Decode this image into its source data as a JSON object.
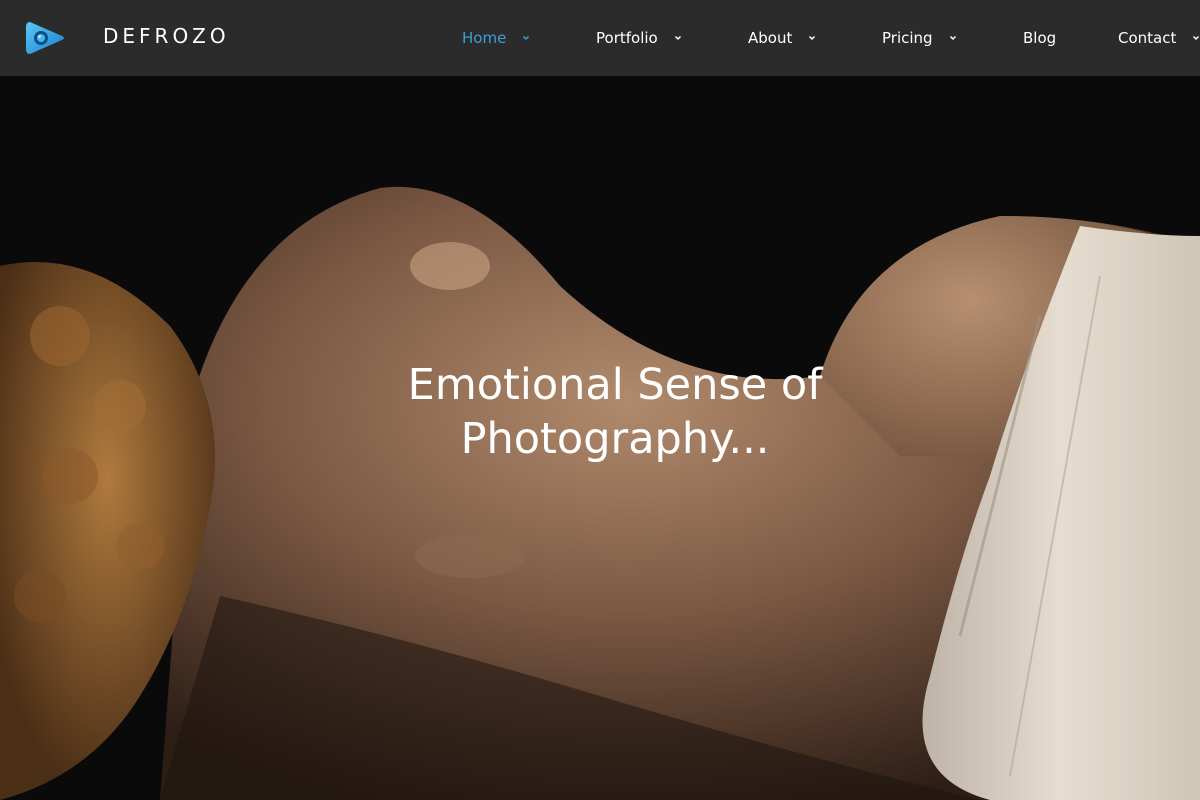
{
  "brand": {
    "name": "DEFROZO",
    "logo_icon": "play-camera-icon",
    "accent_color": "#3a9fd9"
  },
  "nav": {
    "items": [
      {
        "label": "Home",
        "active": true,
        "has_dropdown": true
      },
      {
        "label": "Portfolio",
        "active": false,
        "has_dropdown": true
      },
      {
        "label": "About",
        "active": false,
        "has_dropdown": true
      },
      {
        "label": "Pricing",
        "active": false,
        "has_dropdown": true
      },
      {
        "label": "Blog",
        "active": false,
        "has_dropdown": false
      },
      {
        "label": "Contact",
        "active": false,
        "has_dropdown": true
      }
    ]
  },
  "hero": {
    "title_line1": "Emotional Sense of",
    "title_line2": "Photography..."
  }
}
